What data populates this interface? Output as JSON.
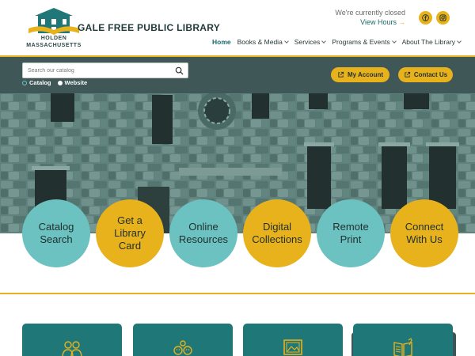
{
  "header": {
    "logo_line1": "HOLDEN",
    "logo_line2": "MASSACHUSETTS",
    "library_name": "GALE FREE PUBLIC LIBRARY",
    "status_text": "We're currently closed",
    "hours_link": "View Hours",
    "hours_arrow": "→",
    "social": [
      "facebook-icon",
      "instagram-icon"
    ]
  },
  "nav": {
    "items": [
      {
        "label": "Home",
        "active": true
      },
      {
        "label": "Books & Media"
      },
      {
        "label": "Services"
      },
      {
        "label": "Programs & Events"
      },
      {
        "label": "About The Library"
      }
    ]
  },
  "search": {
    "placeholder": "Search our catalog",
    "options": [
      "Catalog",
      "Website"
    ],
    "selected": "Catalog"
  },
  "actions": {
    "account_label": "My Account",
    "contact_label": "Contact Us"
  },
  "quick_links": [
    {
      "line1": "Catalog",
      "line2": "Search",
      "line3": ""
    },
    {
      "line1": "Get a",
      "line2": "Library",
      "line3": "Card"
    },
    {
      "line1": "Online",
      "line2": "Resources",
      "line3": ""
    },
    {
      "line1": "Digital",
      "line2": "Collections",
      "line3": ""
    },
    {
      "line1": "Remote",
      "line2": "Print",
      "line3": ""
    },
    {
      "line1": "Connect",
      "line2": "With Us",
      "line3": ""
    }
  ],
  "colors": {
    "teal_dark": "#1f7777",
    "teal_light": "#6cc2c0",
    "gold": "#e8b21c",
    "slate": "#3f5757"
  },
  "cards": [
    {
      "icon": "people-icon"
    },
    {
      "icon": "kids-icon"
    },
    {
      "icon": "image-icon"
    },
    {
      "icon": "book-icon"
    }
  ]
}
